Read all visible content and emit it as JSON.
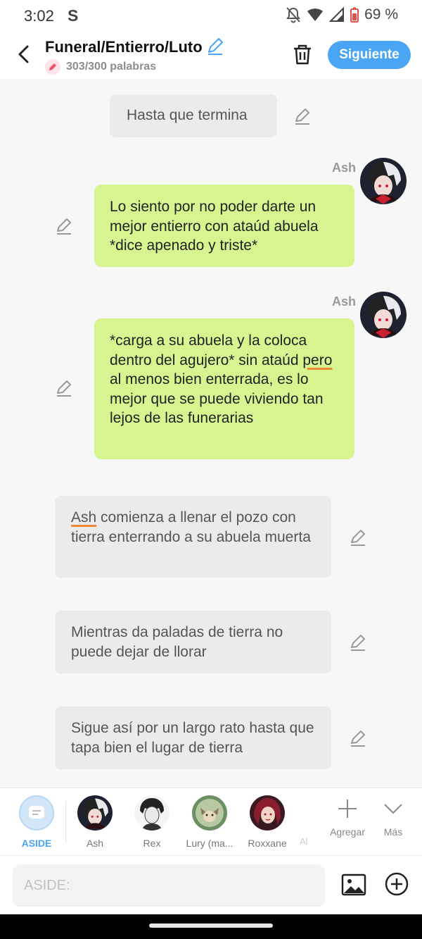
{
  "status_bar": {
    "time": "3:02",
    "carrier_letter": "S",
    "battery_percent": "69 %"
  },
  "header": {
    "title": "Funeral/Entierro/Luto",
    "word_count": "303/300 palabras",
    "next_label": "Siguiente"
  },
  "messages": [
    {
      "type": "narration",
      "text": "Hasta que termina"
    },
    {
      "type": "character",
      "sender": "Ash",
      "text": "Lo siento por no poder darte un mejor entierro con ataúd abuela *dice apenado y triste*"
    },
    {
      "type": "character",
      "sender": "Ash",
      "text_lines": [
        "*carga a su abuela y la coloca dentro del agujero* sin ataúd",
        "pero",
        " al menos bien enterrada, es lo mejor que se puede viviendo tan lejos de las funerarias"
      ]
    },
    {
      "type": "narration",
      "text_parts": [
        "Ash",
        " comienza a llenar el pozo con tierra enterrando a su abuela muerta"
      ]
    },
    {
      "type": "narration",
      "text": "Mientras da paladas de tierra no puede dejar de llorar"
    },
    {
      "type": "narration",
      "text": "Sigue así por un largo rato hasta que tapa bien el lugar de tierra"
    }
  ],
  "characters": [
    {
      "label": "ASIDE",
      "selected": true
    },
    {
      "label": "Ash"
    },
    {
      "label": "Rex"
    },
    {
      "label": "Lury (ma..."
    },
    {
      "label": "Roxxane"
    },
    {
      "label": "Al"
    }
  ],
  "tools": {
    "add_label": "Agregar",
    "more_label": "Más"
  },
  "input": {
    "placeholder": "ASIDE:"
  },
  "colors": {
    "accent": "#4ba5f5",
    "character_bubble": "#d6f590",
    "narration_bubble": "#ebebeb",
    "background": "#f7f7f7"
  }
}
